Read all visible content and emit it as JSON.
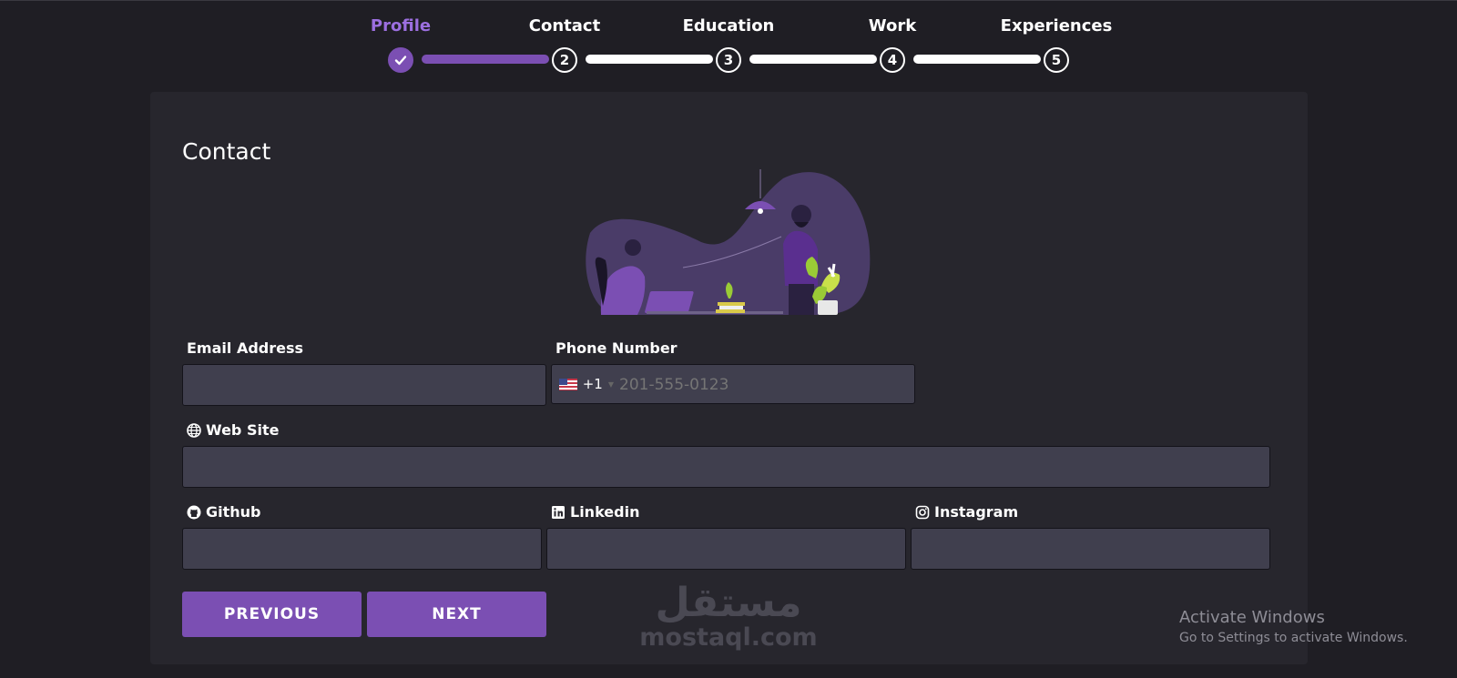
{
  "stepper": {
    "steps": [
      {
        "label": "Profile",
        "number": "",
        "state": "done"
      },
      {
        "label": "Contact",
        "number": "2",
        "state": "current"
      },
      {
        "label": "Education",
        "number": "3",
        "state": "todo"
      },
      {
        "label": "Work",
        "number": "4",
        "state": "todo"
      },
      {
        "label": "Experiences",
        "number": "5",
        "state": "todo"
      }
    ]
  },
  "form": {
    "title": "Contact",
    "email_label": "Email Address",
    "email_value": "",
    "phone_label": "Phone Number",
    "phone_country_code": "+1",
    "phone_placeholder": "201-555-0123",
    "website_label": "Web Site",
    "github_label": "Github",
    "linkedin_label": "Linkedin",
    "instagram_label": "Instagram"
  },
  "buttons": {
    "previous": "PREVIOUS",
    "next": "NEXT"
  },
  "watermark": {
    "arabic": "مستقل",
    "latin": "mostaql.com"
  },
  "windows_notice": {
    "title": "Activate Windows",
    "subtitle": "Go to Settings to activate Windows."
  },
  "colors": {
    "accent": "#7b4fb3",
    "accent_text": "#9c6fe0",
    "background": "#1f1e24",
    "card": "#27262d",
    "field": "#403f4e"
  }
}
